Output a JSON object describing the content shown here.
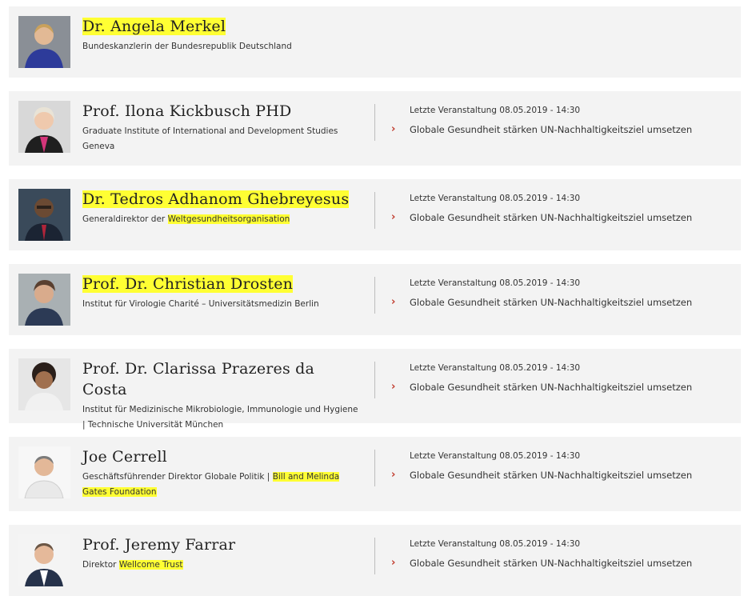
{
  "colors": {
    "highlight": "#ffff33",
    "chevron": "#c0392b",
    "card_bg": "#f3f3f3"
  },
  "people": [
    {
      "name": "Dr. Angela Merkel",
      "name_highlighted": true,
      "desc_plain": "Bundeskanzlerin der Bundesrepublik Deutschland",
      "desc_link": "",
      "has_event": false,
      "event_date": "",
      "event_title": ""
    },
    {
      "name": "Prof. Ilona Kickbusch PHD",
      "name_highlighted": false,
      "desc_plain": "Graduate Institute of International and Development Studies Geneva",
      "desc_link": "",
      "has_event": true,
      "event_date": "Letzte Veranstaltung 08.05.2019 - 14:30",
      "event_title": "Globale Gesundheit stärken UN-Nachhaltigkeitsziel umsetzen"
    },
    {
      "name": "Dr. Tedros Adhanom Ghebreyesus",
      "name_highlighted": true,
      "desc_plain": "Generaldirektor der ",
      "desc_link": "Weltgesundheitsorganisation",
      "has_event": true,
      "event_date": "Letzte Veranstaltung 08.05.2019 - 14:30",
      "event_title": "Globale Gesundheit stärken UN-Nachhaltigkeitsziel umsetzen"
    },
    {
      "name": "Prof. Dr. Christian Drosten",
      "name_highlighted": true,
      "desc_plain": "Institut für Virologie Charité – Universitätsmedizin Berlin",
      "desc_link": "",
      "has_event": true,
      "event_date": "Letzte Veranstaltung 08.05.2019 - 14:30",
      "event_title": "Globale Gesundheit stärken UN-Nachhaltigkeitsziel umsetzen"
    },
    {
      "name": "Prof. Dr. Clarissa Prazeres da Costa",
      "name_highlighted": false,
      "desc_plain": "Institut für Medizinische Mikrobiologie, Immunologie und Hygiene | Technische Universität München",
      "desc_link": "",
      "has_event": true,
      "event_date": "Letzte Veranstaltung 08.05.2019 - 14:30",
      "event_title": "Globale Gesundheit stärken UN-Nachhaltigkeitsziel umsetzen"
    },
    {
      "name": "Joe Cerrell",
      "name_highlighted": false,
      "desc_plain": "Geschäftsführender Direktor Globale Politik | ",
      "desc_link": "Bill and Melinda Gates Foundation",
      "has_event": true,
      "event_date": "Letzte Veranstaltung 08.05.2019 - 14:30",
      "event_title": "Globale Gesundheit stärken UN-Nachhaltigkeitsziel umsetzen"
    },
    {
      "name": "Prof. Jeremy Farrar",
      "name_highlighted": false,
      "desc_plain": "Direktor ",
      "desc_link": "Wellcome Trust",
      "has_event": true,
      "event_date": "Letzte Veranstaltung 08.05.2019 - 14:30",
      "event_title": "Globale Gesundheit stärken UN-Nachhaltigkeitsziel umsetzen"
    }
  ]
}
